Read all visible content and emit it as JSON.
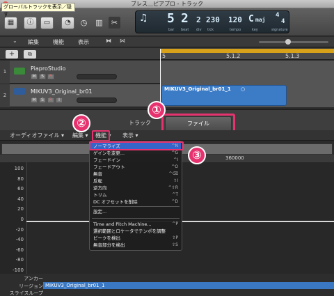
{
  "window": {
    "title": "ブレス＿ピアプロ - トラック"
  },
  "tooltip": {
    "text": "グローバルトラックを表示／隠す"
  },
  "lcd": {
    "bar": "5",
    "beat": "2",
    "div": "2",
    "tick": "230",
    "bar_lbl": "bar",
    "beat_lbl": "beat",
    "div_lbl": "div",
    "tick_lbl": "tick",
    "tempo": "120",
    "tempo_lbl": "tempo",
    "key": "C",
    "key_mode": "maj",
    "key_lbl": "key",
    "sig_top": "4",
    "sig_bottom": "4",
    "sig_lbl": "signature"
  },
  "toolbar2": {
    "edit": "編集",
    "function": "機能",
    "view": "表示"
  },
  "ruler": {
    "marks": [
      "5",
      "5.1.2",
      "5.1.3"
    ]
  },
  "tracks": [
    {
      "num": "1",
      "name": "PiaproStudio",
      "m": "M",
      "s": "S",
      "r": "R"
    },
    {
      "num": "2",
      "name": "MIKUV3_Original_br01",
      "m": "M",
      "s": "S",
      "r": "R",
      "i": "I"
    }
  ],
  "region": {
    "label": "MIKUV3_Original_br01_1"
  },
  "editor": {
    "tab_track": "トラック",
    "tab_file": "ファイル",
    "local_menu": {
      "audio_file": "オーディオファイル ▾",
      "edit": "編集 ▾",
      "function": "機能 ▾",
      "view": "表示 ▾"
    }
  },
  "timeline": {
    "label": "360000"
  },
  "yaxis": [
    "100",
    "80",
    "60",
    "40",
    "20",
    "0",
    "-20",
    "-40",
    "-60",
    "-80",
    "-100"
  ],
  "bottom": {
    "anchor": "アンカー",
    "region": "リージョン",
    "slice_loop": "スライスループ",
    "region_name": "MIKUV3_Original_br01_1"
  },
  "menu_items": [
    {
      "label": "ノーマライズ",
      "shortcut": "^N"
    },
    {
      "label": "ゲインを変更...",
      "shortcut": "^G"
    },
    {
      "label": "フェードイン",
      "shortcut": "^I"
    },
    {
      "label": "フェードアウト",
      "shortcut": "^O"
    },
    {
      "label": "無音",
      "shortcut": "^⌫"
    },
    {
      "label": "反転",
      "shortcut": "⇧I"
    },
    {
      "label": "逆方向",
      "shortcut": "^⇧R"
    },
    {
      "label": "トリム",
      "shortcut": "^T"
    },
    {
      "label": "DC オフセットを削除",
      "shortcut": "^D"
    },
    {
      "label": "設定...",
      "shortcut": ""
    },
    {
      "label": "Time and Pitch Machine...",
      "shortcut": "^P"
    },
    {
      "label": "選択範囲とロケータでテンポを調整",
      "shortcut": ""
    },
    {
      "label": "ピークを検出",
      "shortcut": "⇧P"
    },
    {
      "label": "無音部分を検出",
      "shortcut": "⇧S"
    }
  ],
  "callouts": [
    "①",
    "②",
    "③"
  ],
  "colors": {
    "accent_pink": "#e6336f",
    "region_blue": "#3c7cc7",
    "cycle_yellow": "#d7a21a",
    "menu_highlight": "#3565c9"
  }
}
